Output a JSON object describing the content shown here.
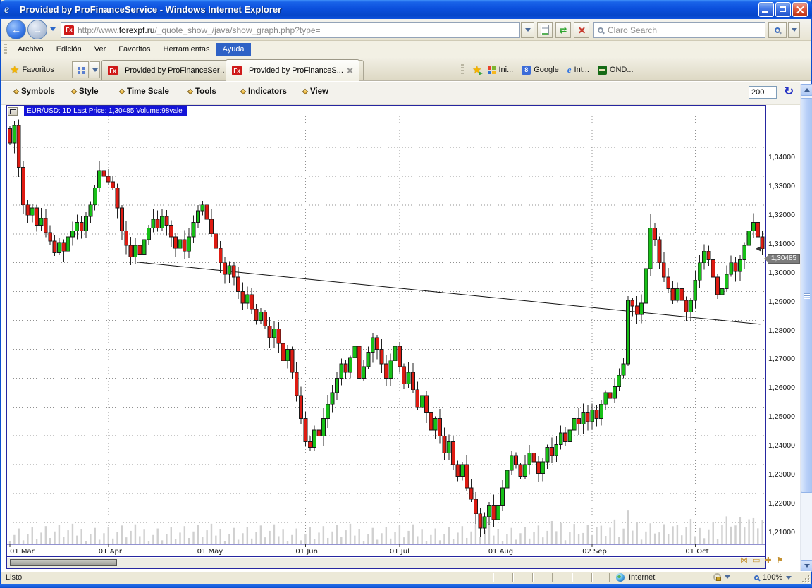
{
  "window": {
    "title": "Provided by ProFinanceService - Windows Internet Explorer"
  },
  "address_bar": {
    "url_prefix": "http://www.",
    "url_domain": "forexpf.ru",
    "url_path": "/_quote_show_/java/show_graph.php?type=",
    "search_placeholder": "Claro Search"
  },
  "menu_bar": {
    "items": [
      "Archivo",
      "Edición",
      "Ver",
      "Favoritos",
      "Herramientas",
      "Ayuda"
    ],
    "active": "Ayuda"
  },
  "favorites_bar": {
    "favoritos_label": "Favoritos",
    "tabs": [
      {
        "label": "Provided by ProFinanceService",
        "active": false
      },
      {
        "label": "Provided by ProFinanceS...",
        "active": true
      }
    ],
    "links": [
      {
        "icon": "windows-flag-icon",
        "label": "Ini..."
      },
      {
        "icon": "google-icon",
        "label": "Google"
      },
      {
        "icon": "ie-icon",
        "label": "Int..."
      },
      {
        "icon": "oanda-icon",
        "label": "OND..."
      }
    ]
  },
  "chart_toolbar": {
    "menus": [
      "Symbols",
      "Style",
      "Time Scale",
      "Tools",
      "Indicators",
      "View"
    ],
    "menu_lefts": [
      18,
      100,
      168,
      265,
      340,
      428
    ],
    "bars_value": "200"
  },
  "chart_header": {
    "text": "EUR/USD: 1D Last Price: 1,30485 Volume:98vale"
  },
  "chart_data": {
    "type": "candlestick",
    "symbol": "EUR/USD",
    "timeframe": "1D",
    "last_price": 1.30485,
    "last_price_label": "1,30485",
    "ylim": [
      1.2025,
      1.3505
    ],
    "y_ticks": [
      "1,34000",
      "1,33000",
      "1,32000",
      "1,31000",
      "1,30000",
      "1,29000",
      "1,28000",
      "1,27000",
      "1,26000",
      "1,25000",
      "1,24000",
      "1,23000",
      "1,22000",
      "1,21000"
    ],
    "x_labels": [
      {
        "label": "01 Mar",
        "day": 0
      },
      {
        "label": "01 Apr",
        "day": 22
      },
      {
        "label": "01 May",
        "day": 44
      },
      {
        "label": "01 Jun",
        "day": 66
      },
      {
        "label": "01 Jul",
        "day": 87
      },
      {
        "label": "01 Aug",
        "day": 109
      },
      {
        "label": "02 Sep",
        "day": 130
      },
      {
        "label": "01 Oct",
        "day": 153
      }
    ],
    "first_open": 1.3465,
    "closes": [
      1.3415,
      1.3475,
      1.333,
      1.32,
      1.3165,
      1.319,
      1.313,
      1.3155,
      1.3105,
      1.3075,
      1.3035,
      1.307,
      1.304,
      1.309,
      1.311,
      1.314,
      1.311,
      1.316,
      1.32,
      1.326,
      1.332,
      1.33,
      1.328,
      1.326,
      1.319,
      1.311,
      1.306,
      1.302,
      1.306,
      1.303,
      1.308,
      1.312,
      1.315,
      1.312,
      1.316,
      1.313,
      1.309,
      1.305,
      1.308,
      1.304,
      1.309,
      1.314,
      1.318,
      1.32,
      1.315,
      1.31,
      1.305,
      1.3,
      1.296,
      1.299,
      1.295,
      1.29,
      1.286,
      1.289,
      1.284,
      1.28,
      1.283,
      1.278,
      1.274,
      1.277,
      1.272,
      1.266,
      1.27,
      1.262,
      1.254,
      1.246,
      1.238,
      1.236,
      1.242,
      1.24,
      1.246,
      1.251,
      1.255,
      1.26,
      1.265,
      1.262,
      1.267,
      1.271,
      1.26,
      1.264,
      1.269,
      1.274,
      1.27,
      1.265,
      1.26,
      1.266,
      1.271,
      1.264,
      1.258,
      1.262,
      1.256,
      1.25,
      1.254,
      1.248,
      1.242,
      1.246,
      1.24,
      1.234,
      1.238,
      1.23,
      1.226,
      1.23,
      1.222,
      1.218,
      1.213,
      1.208,
      1.212,
      1.216,
      1.211,
      1.216,
      1.222,
      1.228,
      1.233,
      1.23,
      1.226,
      1.23,
      1.234,
      1.231,
      1.227,
      1.231,
      1.236,
      1.233,
      1.237,
      1.241,
      1.238,
      1.242,
      1.246,
      1.244,
      1.248,
      1.245,
      1.249,
      1.246,
      1.251,
      1.255,
      1.253,
      1.257,
      1.261,
      1.265,
      1.287,
      1.285,
      1.282,
      1.286,
      1.298,
      1.312,
      1.308,
      1.3,
      1.295,
      1.291,
      1.287,
      1.291,
      1.287,
      1.283,
      1.287,
      1.294,
      1.3,
      1.304,
      1.301,
      1.295,
      1.289,
      1.291,
      1.296,
      1.3,
      1.297,
      1.301,
      1.306,
      1.311,
      1.314,
      1.309,
      1.30485
    ],
    "wick_overrides": {
      "1": {
        "high": 1.349
      },
      "105": {
        "low": 1.205
      },
      "106": {
        "low": 1.206
      },
      "143": {
        "high": 1.317
      }
    },
    "trendline": {
      "day1": 28.5,
      "price1": 1.3002,
      "day2": 167.5,
      "price2": 1.2787
    },
    "grid": true,
    "colors": {
      "up": "#17C017",
      "down": "#DE1B12",
      "outline": "#1A1A1A",
      "wick": "#222222",
      "volume": "#D0D0D0",
      "grid": "#909090",
      "frame": "#2626A0",
      "header_highlight": "#1414D8",
      "badge": "#7D7D7D"
    }
  },
  "mini_tools": {
    "icons": [
      "join-icon",
      "minimize-chart-icon",
      "add-chart-icon",
      "flag-icon"
    ],
    "glyphs": [
      "⋈",
      "▭",
      "✚",
      "⚑"
    ]
  },
  "status_bar": {
    "ready": "Listo",
    "zone": "Internet",
    "zoom": "100%"
  }
}
